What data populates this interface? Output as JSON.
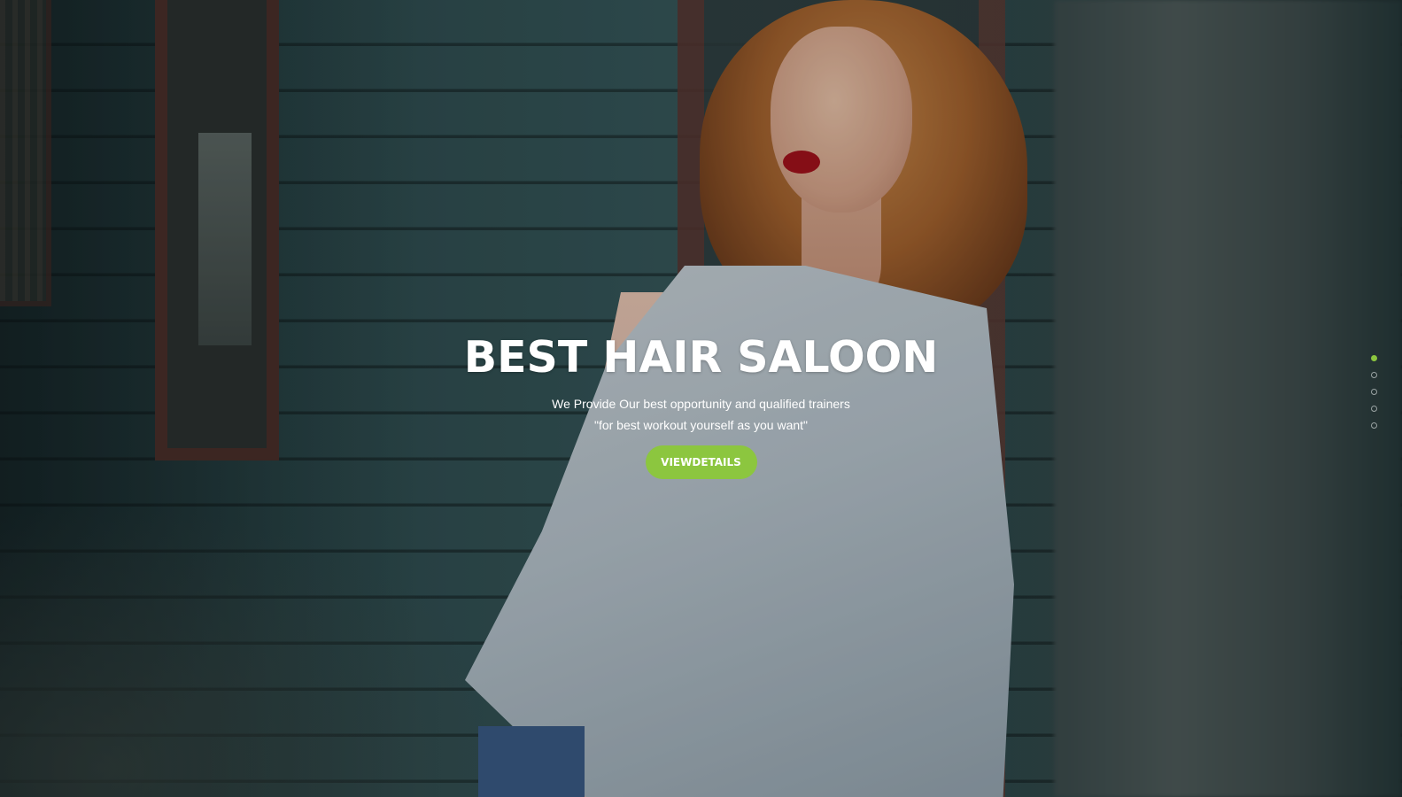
{
  "hero": {
    "title": "BEST HAIR SALOON",
    "subtitle_line1": "We Provide Our best opportunity and qualified trainers",
    "subtitle_line2": "\"for best workout yourself as you want\"",
    "button_label": "VIEWDETAILS"
  },
  "slider": {
    "slide_count": 5,
    "active_index": 0
  },
  "colors": {
    "accent": "#8cc63f",
    "text": "#ffffff"
  }
}
